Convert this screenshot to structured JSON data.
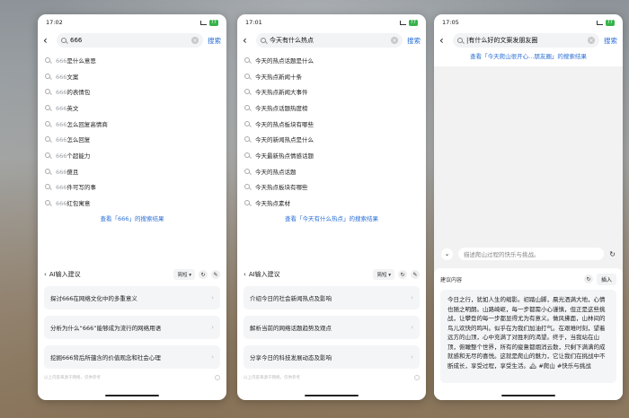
{
  "accent": "#2a6fd6",
  "phone1": {
    "status": {
      "time": "17:02",
      "battery": "77"
    },
    "search": {
      "query": "666",
      "button": "搜索"
    },
    "suggestions": [
      {
        "hl": "666",
        "rest": "是什么意思"
      },
      {
        "hl": "666",
        "rest": "文案"
      },
      {
        "hl": "666",
        "rest": "的表情包"
      },
      {
        "hl": "666",
        "rest": "英文"
      },
      {
        "hl": "666",
        "rest": "怎么回复高情商"
      },
      {
        "hl": "666",
        "rest": "怎么回复"
      },
      {
        "hl": "666",
        "rest": "个超能力"
      },
      {
        "hl": "666",
        "rest": "傻且"
      },
      {
        "hl": "666",
        "rest": "件可写的事"
      },
      {
        "hl": "666",
        "rest": "红包寓意"
      }
    ],
    "more_link": "查看「666」的搜索结果",
    "ai": {
      "title": "AI输入建议",
      "mode": "简短",
      "cards": [
        "探讨666在网络文化中的多重意义",
        "分析为什么“666”能够成为流行的网络用语",
        "挖掘666背后所蕴含的价值观念和社会心理"
      ],
      "footer": "以上内容来源于网络，仅供参考"
    }
  },
  "phone2": {
    "status": {
      "time": "17:01",
      "battery": "77"
    },
    "search": {
      "query": "今天有什么热点",
      "button": "搜索"
    },
    "suggestions": [
      "今天的热点话题是什么",
      "今天热点新闻十条",
      "今天热点新闻大事件",
      "今天热点话题热度榜",
      "今天的热点板块有哪些",
      "今天的新闻热点是什么",
      "今天最新热点情感话题",
      "今天的热点话题",
      "今天热点板块有哪些",
      "今天热点素材"
    ],
    "more_link": "查看「今天有什么热点」的搜索结果",
    "ai": {
      "title": "AI输入建议",
      "mode": "简短",
      "cards": [
        "介绍今日的社会新闻热点及影响",
        "解析当前的网络话题趋势及观点",
        "分享今日的科技发展动态及影响"
      ],
      "footer": "以上内容来源于网络，仅供参考"
    }
  },
  "phone3": {
    "status": {
      "time": "17:05",
      "battery": "77"
    },
    "search": {
      "query": "|有什么好的文案发朋友圈",
      "button": "搜索"
    },
    "more_link": "查看「今天爬山很开心...朋友圈」的搜索结果",
    "input": {
      "placeholder": "描述爬山过程的快乐与挑战。"
    },
    "panel": {
      "label": "建议内容",
      "insert": "插入",
      "content": "今日之行，犹如人生的缩影。初踏山脚，晨光洒满大地，心情也随之明朗。山路崎岖，每一步都需小心谨慎，但正是这些挑战，让攀登的每一步都显得尤为有意义。做风拂面，山林间的鸟儿欢快的鸣叫。似乎在为我们加油打气。在艰难时刻，望着远方的山顶，心中充满了对胜利的渴望。终于，当我站在山顶，俯瞰整个世界，所有的疲惫都烟消云散，只剩下满满的成就感和无尽的喜悦。这就是爬山的魅力，它让我们在挑战中不断成长，享受过程，享受生活。🏔 #爬山 #快乐与挑战"
    }
  }
}
